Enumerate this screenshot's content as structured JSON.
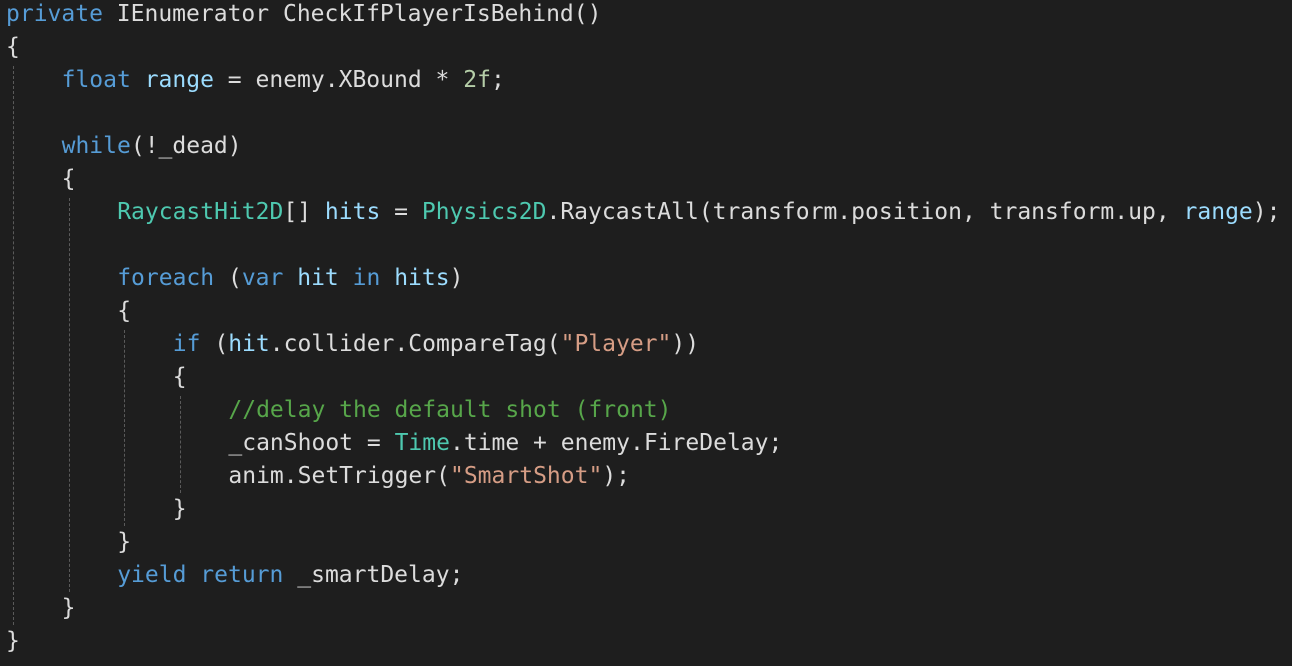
{
  "editor": {
    "colors": {
      "background": "#1e1e1e",
      "default": "#dcdcdc",
      "keyword": "#569cd6",
      "type": "#4ec9b0",
      "local": "#9cdcfe",
      "string": "#d69d85",
      "comment": "#57a64a",
      "number": "#b5cea8"
    },
    "lines": [
      {
        "indent": 0,
        "tokens": [
          {
            "t": "private",
            "c": "keyword"
          },
          {
            "t": " "
          },
          {
            "t": "IEnumerator"
          },
          {
            "t": " "
          },
          {
            "t": "CheckIfPlayerIsBehind"
          },
          {
            "t": "()"
          }
        ]
      },
      {
        "indent": 0,
        "tokens": [
          {
            "t": "{"
          }
        ]
      },
      {
        "indent": 1,
        "tokens": [
          {
            "t": "float",
            "c": "keyword"
          },
          {
            "t": " "
          },
          {
            "t": "range",
            "c": "local"
          },
          {
            "t": " = "
          },
          {
            "t": "enemy"
          },
          {
            "t": "."
          },
          {
            "t": "XBound"
          },
          {
            "t": " * "
          },
          {
            "t": "2f",
            "c": "number"
          },
          {
            "t": ";"
          }
        ]
      },
      {
        "indent": 0,
        "tokens": []
      },
      {
        "indent": 1,
        "tokens": [
          {
            "t": "while",
            "c": "keyword"
          },
          {
            "t": "(!"
          },
          {
            "t": "_dead"
          },
          {
            "t": ")"
          }
        ]
      },
      {
        "indent": 1,
        "tokens": [
          {
            "t": "{"
          }
        ]
      },
      {
        "indent": 2,
        "tokens": [
          {
            "t": "RaycastHit2D",
            "c": "type"
          },
          {
            "t": "[] "
          },
          {
            "t": "hits",
            "c": "local"
          },
          {
            "t": " = "
          },
          {
            "t": "Physics2D",
            "c": "type"
          },
          {
            "t": "."
          },
          {
            "t": "RaycastAll"
          },
          {
            "t": "("
          },
          {
            "t": "transform"
          },
          {
            "t": "."
          },
          {
            "t": "position"
          },
          {
            "t": ", "
          },
          {
            "t": "transform"
          },
          {
            "t": "."
          },
          {
            "t": "up"
          },
          {
            "t": ", "
          },
          {
            "t": "range",
            "c": "local"
          },
          {
            "t": ");"
          }
        ]
      },
      {
        "indent": 0,
        "tokens": []
      },
      {
        "indent": 2,
        "tokens": [
          {
            "t": "foreach",
            "c": "keyword"
          },
          {
            "t": " ("
          },
          {
            "t": "var",
            "c": "keyword"
          },
          {
            "t": " "
          },
          {
            "t": "hit",
            "c": "local"
          },
          {
            "t": " "
          },
          {
            "t": "in",
            "c": "keyword"
          },
          {
            "t": " "
          },
          {
            "t": "hits",
            "c": "local"
          },
          {
            "t": ")"
          }
        ]
      },
      {
        "indent": 2,
        "tokens": [
          {
            "t": "{"
          }
        ]
      },
      {
        "indent": 3,
        "tokens": [
          {
            "t": "if",
            "c": "keyword"
          },
          {
            "t": " ("
          },
          {
            "t": "hit",
            "c": "local"
          },
          {
            "t": "."
          },
          {
            "t": "collider"
          },
          {
            "t": "."
          },
          {
            "t": "CompareTag"
          },
          {
            "t": "("
          },
          {
            "t": "\"Player\"",
            "c": "string"
          },
          {
            "t": "))"
          }
        ]
      },
      {
        "indent": 3,
        "tokens": [
          {
            "t": "{"
          }
        ]
      },
      {
        "indent": 4,
        "tokens": [
          {
            "t": "//delay the default shot (front)",
            "c": "comment"
          }
        ]
      },
      {
        "indent": 4,
        "tokens": [
          {
            "t": "_canShoot"
          },
          {
            "t": " = "
          },
          {
            "t": "Time",
            "c": "type"
          },
          {
            "t": "."
          },
          {
            "t": "time"
          },
          {
            "t": " + "
          },
          {
            "t": "enemy"
          },
          {
            "t": "."
          },
          {
            "t": "FireDelay"
          },
          {
            "t": ";"
          }
        ]
      },
      {
        "indent": 4,
        "tokens": [
          {
            "t": "anim"
          },
          {
            "t": "."
          },
          {
            "t": "SetTrigger"
          },
          {
            "t": "("
          },
          {
            "t": "\"SmartShot\"",
            "c": "string"
          },
          {
            "t": ");"
          }
        ]
      },
      {
        "indent": 3,
        "tokens": [
          {
            "t": "}"
          }
        ]
      },
      {
        "indent": 2,
        "tokens": [
          {
            "t": "}"
          }
        ]
      },
      {
        "indent": 2,
        "tokens": [
          {
            "t": "yield",
            "c": "keyword"
          },
          {
            "t": " "
          },
          {
            "t": "return",
            "c": "keyword"
          },
          {
            "t": " "
          },
          {
            "t": "_smartDelay"
          },
          {
            "t": ";"
          }
        ]
      },
      {
        "indent": 1,
        "tokens": [
          {
            "t": "}"
          }
        ]
      },
      {
        "indent": 0,
        "tokens": [
          {
            "t": "}"
          }
        ]
      }
    ]
  }
}
